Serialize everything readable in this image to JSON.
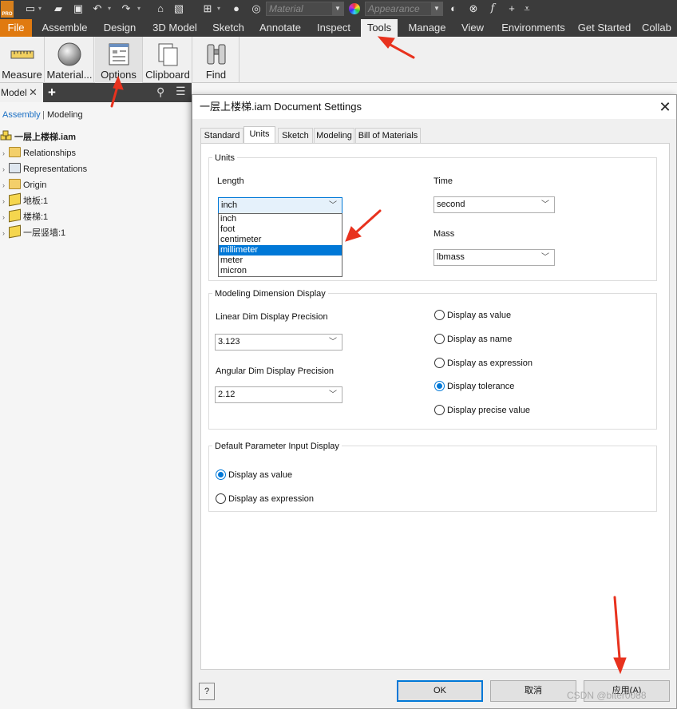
{
  "quick_access": {
    "logo_text": "PRO",
    "material_placeholder": "Material",
    "appearance_placeholder": "Appearance"
  },
  "ribbon_tabs": [
    "File",
    "Assemble",
    "Design",
    "3D Model",
    "Sketch",
    "Annotate",
    "Inspect",
    "Tools",
    "Manage",
    "View",
    "Environments",
    "Get Started",
    "Collab"
  ],
  "active_tab": "Tools",
  "ribbon_buttons": [
    "Measure",
    "Material...",
    "Options",
    "Clipboard",
    "Find"
  ],
  "browser": {
    "tab_label": "Model",
    "subtabs": {
      "assembly": "Assembly",
      "modeling": "Modeling"
    },
    "tree": [
      {
        "label": "一层上楼梯.iam",
        "kind": "assembly"
      },
      {
        "label": "Relationships",
        "kind": "folder"
      },
      {
        "label": "Representations",
        "kind": "folder"
      },
      {
        "label": "Origin",
        "kind": "folder"
      },
      {
        "label": "地板:1",
        "kind": "part"
      },
      {
        "label": "楼梯:1",
        "kind": "part"
      },
      {
        "label": "一层竖墙:1",
        "kind": "part"
      }
    ]
  },
  "dialog": {
    "title": "一层上楼梯.iam Document Settings",
    "tabs": [
      "Standard",
      "Units",
      "Sketch",
      "Modeling",
      "Bill of Materials"
    ],
    "active_tab": "Units",
    "units": {
      "group_title": "Units",
      "length_label": "Length",
      "length_value": "inch",
      "length_options": [
        "inch",
        "foot",
        "centimeter",
        "millimeter",
        "meter",
        "micron"
      ],
      "length_highlighted": "millimeter",
      "time_label": "Time",
      "time_value": "second",
      "mass_label": "Mass",
      "mass_value": "lbmass"
    },
    "modeling_dim": {
      "group_title": "Modeling Dimension Display",
      "linear_label": "Linear Dim Display Precision",
      "linear_value": "3.123",
      "angular_label": "Angular Dim Display Precision",
      "angular_value": "2.12",
      "radio_options": [
        "Display as value",
        "Display as name",
        "Display as expression",
        "Display tolerance",
        "Display precise value"
      ],
      "radio_selected": "Display tolerance"
    },
    "param_input": {
      "group_title": "Default Parameter Input Display",
      "options": [
        "Display as value",
        "Display as expression"
      ],
      "selected": "Display as value"
    },
    "buttons": {
      "help": "?",
      "ok": "OK",
      "cancel": "取消",
      "apply": "应用(A)"
    }
  },
  "watermark": "CSDN @biter0088",
  "colors": {
    "accent": "#0078d7",
    "file_tab": "#e07a10",
    "annotation_arrow": "#e8321e",
    "dark_ui": "#3b3b3b"
  }
}
